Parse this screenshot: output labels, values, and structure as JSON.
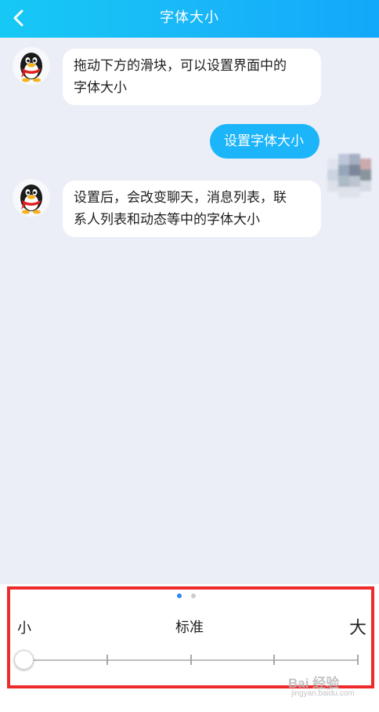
{
  "header": {
    "title": "字体大小",
    "back_icon": "chevron-left-icon",
    "color_start": "#16c9f5",
    "color_end": "#12a8fb"
  },
  "chat": {
    "background": "#ebeef6",
    "messages": [
      {
        "from": "qq",
        "lines": [
          "拖动下方的滑块，可以设置界面中的",
          "字体大小"
        ]
      },
      {
        "from": "self",
        "lines": [
          "设置字体大小"
        ]
      },
      {
        "from": "qq",
        "lines": [
          "设置后，会改变聊天，消息列表，联",
          "系人列表和动态等中的字体大小"
        ]
      }
    ],
    "self_bubble_color": "#1db5fa"
  },
  "font_size_panel": {
    "page_dots": {
      "count": 2,
      "active": 0,
      "active_color": "#2f86f6",
      "inactive_color": "#cccccc"
    },
    "labels": {
      "small": "小",
      "standard": "标准",
      "large": "大"
    },
    "slider": {
      "steps": 5,
      "selected_index": 0
    }
  },
  "highlight_color": "#ee2b2b",
  "watermark": {
    "text": "Bai 经验",
    "sub": "jingyan.baidu.com"
  }
}
